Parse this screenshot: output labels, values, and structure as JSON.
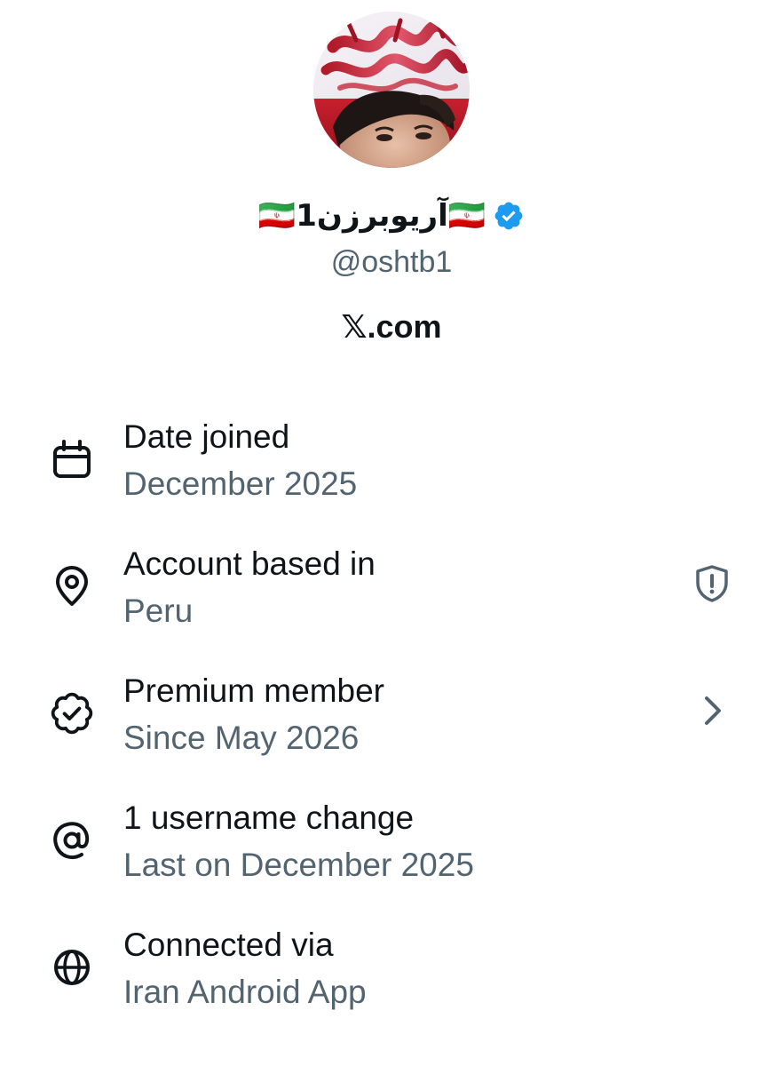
{
  "profile": {
    "display_name": "🇮🇷آريوبرزن1🇮🇷",
    "handle": "@oshtb1",
    "site": "𝕏.com",
    "verified": true
  },
  "about": {
    "rows": [
      {
        "title": "Date joined",
        "subtitle": "December 2025",
        "icon": "calendar-icon"
      },
      {
        "title": "Account based in",
        "subtitle": "Peru",
        "icon": "location-pin-icon",
        "trailing_icon": "shield-alert-icon"
      },
      {
        "title": "Premium member",
        "subtitle": "Since May 2026",
        "icon": "verified-badge-outline-icon",
        "trailing_icon": "chevron-right-icon"
      },
      {
        "title": "1 username change",
        "subtitle": "Last on December 2025",
        "icon": "at-sign-icon"
      },
      {
        "title": "Connected via",
        "subtitle": "Iran Android App",
        "icon": "globe-icon"
      }
    ]
  },
  "colors": {
    "primary_text": "#0f1419",
    "secondary_text": "#536471",
    "verified_blue": "#1d9bf0"
  }
}
